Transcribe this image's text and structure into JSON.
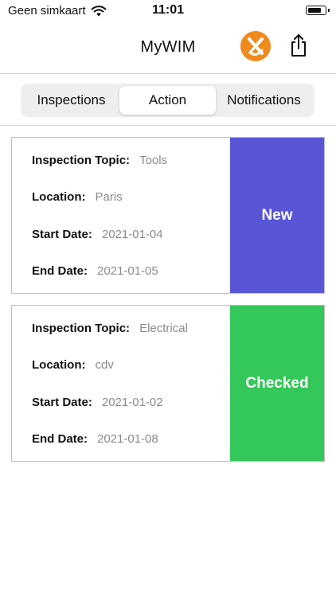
{
  "status_bar": {
    "carrier": "Geen simkaart",
    "time": "11:01"
  },
  "nav": {
    "title": "MyWIM",
    "icons": {
      "logo": "brand-logo-icon",
      "share": "share-icon"
    }
  },
  "tabs": [
    {
      "label": "Inspections",
      "active": false
    },
    {
      "label": "Action",
      "active": true
    },
    {
      "label": "Notifications",
      "active": false
    }
  ],
  "labels": {
    "topic": "Inspection Topic:",
    "location": "Location:",
    "start": "Start Date:",
    "end": "End Date:"
  },
  "cards": [
    {
      "topic": "Tools",
      "location": "Paris",
      "start_date": "2021-01-04",
      "end_date": "2021-01-05",
      "status": "New",
      "status_color": "#5856d6"
    },
    {
      "topic": "Electrical",
      "location": "cdv",
      "start_date": "2021-01-02",
      "end_date": "2021-01-08",
      "status": "Checked",
      "status_color": "#34c759"
    }
  ],
  "colors": {
    "brand_orange": "#f08a1c",
    "segment_bg": "#eeeeef",
    "value_gray": "#8a8a8a"
  }
}
